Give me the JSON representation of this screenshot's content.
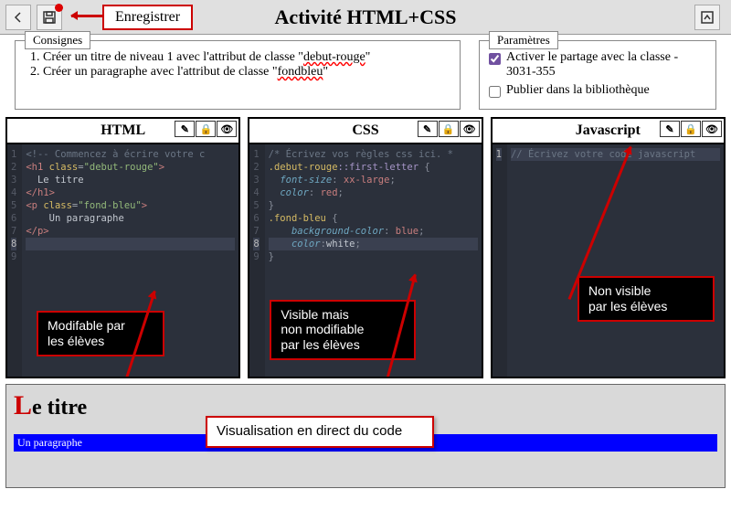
{
  "topbar": {
    "title": "Activité HTML+CSS",
    "save_callout": "Enregistrer"
  },
  "consignes": {
    "legend": "Consignes",
    "items": [
      {
        "pre": "Créer un titre de niveau 1 avec l'attribut de classe \"",
        "wavy": "debut-rouge",
        "post": "\""
      },
      {
        "pre": "Créer un paragraphe avec l'attribut de classe \"",
        "wavy": "fondbleu",
        "post": "\""
      }
    ]
  },
  "parametres": {
    "legend": "Paramètres",
    "share_label": "Activer le partage avec la classe - 3031-355",
    "share_checked": true,
    "publish_label": "Publier dans la bibliothèque",
    "publish_checked": false
  },
  "editors": {
    "html": {
      "title": "HTML",
      "lines": [
        {
          "n": 1,
          "html": "<span class='c-comm'>&lt;!-- Commencez à écrire votre c</span>"
        },
        {
          "n": 2,
          "html": "<span class='c-tag'>&lt;h1</span> <span class='c-attr'>class</span>=<span class='c-str'>\"debut-rouge\"</span><span class='c-tag'>&gt;</span>"
        },
        {
          "n": 3,
          "html": "  <span class='c-txt'>Le titre</span>"
        },
        {
          "n": 4,
          "html": "<span class='c-tag'>&lt;/h1&gt;</span>"
        },
        {
          "n": 5,
          "html": "<span class='c-tag'>&lt;p</span> <span class='c-attr'>class</span>=<span class='c-str'>\"fond-bleu\"</span><span class='c-tag'>&gt;</span>"
        },
        {
          "n": 6,
          "html": "    <span class='c-txt'>Un paragraphe</span>"
        },
        {
          "n": 7,
          "html": "<span class='c-tag'>&lt;/p&gt;</span>"
        },
        {
          "n": 8,
          "html": " ",
          "current": true
        },
        {
          "n": 9,
          "html": " "
        }
      ],
      "annotation": "Modifable par\nles élèves"
    },
    "css": {
      "title": "CSS",
      "lines": [
        {
          "n": 1,
          "html": "<span class='c-comm'>/* Écrivez vos règles css ici. *</span>"
        },
        {
          "n": 2,
          "html": "<span class='c-sel'>.debut-rouge</span><span class='c-pseudo'>::first-letter</span> <span class='c-punct'>{</span>"
        },
        {
          "n": 3,
          "html": "  <span class='c-prop'>font-size</span><span class='c-punct'>:</span> <span class='c-val'>xx-large</span><span class='c-punct'>;</span>"
        },
        {
          "n": 4,
          "html": "  <span class='c-prop'>color</span><span class='c-punct'>:</span> <span class='c-val'>red</span><span class='c-punct'>;</span>"
        },
        {
          "n": 5,
          "html": "<span class='c-punct'>}</span>"
        },
        {
          "n": 6,
          "html": "<span class='c-sel'>.fond-bleu</span> <span class='c-punct'>{</span>"
        },
        {
          "n": 7,
          "html": "    <span class='c-prop'>background-color</span><span class='c-punct'>:</span> <span class='c-val'>blue</span><span class='c-punct'>;</span>"
        },
        {
          "n": 8,
          "html": "    <span class='c-prop'>color</span><span class='c-punct'>:</span><span class='c-txt'>white</span><span class='c-punct'>;</span>",
          "current": true
        },
        {
          "n": 9,
          "html": "<span class='c-punct'>}</span>"
        }
      ],
      "annotation": "Visible mais\nnon modifiable\npar les élèves"
    },
    "js": {
      "title": "Javascript",
      "lines": [
        {
          "n": 1,
          "html": "<span class='c-comm'>// Écrivez votre code javascript</span>",
          "current": true
        }
      ],
      "annotation": "Non visible\npar les élèves"
    }
  },
  "preview": {
    "first_letter": "L",
    "title_rest": "e titre",
    "paragraph": "Un paragraphe",
    "callout": "Visualisation en direct du code"
  }
}
